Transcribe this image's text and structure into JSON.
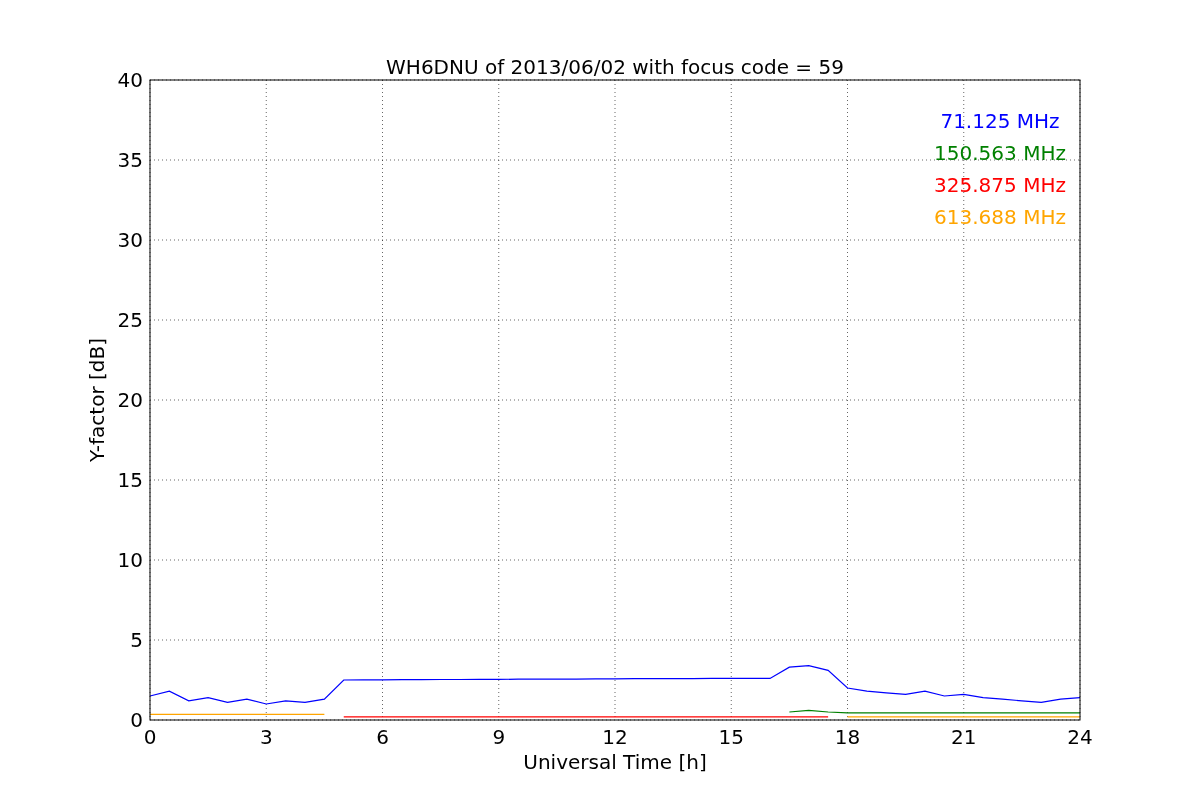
{
  "figure": {
    "chart_data": {
      "type": "line",
      "title": "WH6DNU of 2013/06/02 with focus code = 59",
      "xlabel": "Universal Time [h]",
      "ylabel": "Y-factor [dB]",
      "x": [
        0,
        0.5,
        1,
        1.5,
        2,
        2.5,
        3,
        3.5,
        4,
        4.5,
        5,
        5.5,
        6,
        6.5,
        7,
        7.5,
        8,
        8.5,
        9,
        9.5,
        10,
        10.5,
        11,
        11.5,
        12,
        12.5,
        13,
        13.5,
        14,
        14.5,
        15,
        15.5,
        16,
        16.5,
        17,
        17.5,
        18,
        18.5,
        19,
        19.5,
        20,
        20.5,
        21,
        21.5,
        22,
        22.5,
        23,
        23.5,
        24
      ],
      "series": [
        {
          "name": "71.125 MHz",
          "color": "#0000ff",
          "values": [
            1.5,
            1.8,
            1.2,
            1.4,
            1.1,
            1.3,
            1.0,
            1.2,
            1.1,
            1.3,
            2.5,
            2.51,
            2.51,
            2.52,
            2.52,
            2.53,
            2.53,
            2.54,
            2.54,
            2.55,
            2.55,
            2.56,
            2.56,
            2.57,
            2.57,
            2.58,
            2.58,
            2.59,
            2.59,
            2.6,
            2.6,
            2.6,
            2.6,
            3.3,
            3.4,
            3.1,
            2.0,
            1.8,
            1.7,
            1.6,
            1.8,
            1.5,
            1.6,
            1.4,
            1.3,
            1.2,
            1.1,
            1.3,
            1.4
          ]
        },
        {
          "name": "150.563 MHz",
          "color": "#008000",
          "values": [
            null,
            null,
            null,
            null,
            null,
            null,
            null,
            null,
            null,
            null,
            null,
            null,
            null,
            null,
            null,
            null,
            null,
            null,
            null,
            null,
            null,
            null,
            null,
            null,
            null,
            null,
            null,
            null,
            null,
            null,
            null,
            null,
            null,
            0.5,
            0.6,
            0.5,
            0.45,
            0.45,
            0.45,
            0.45,
            0.45,
            0.45,
            0.45,
            0.45,
            0.45,
            0.45,
            0.45,
            0.45,
            0.45
          ]
        },
        {
          "name": "325.875 MHz",
          "color": "#ff0000",
          "values": [
            null,
            null,
            null,
            null,
            null,
            null,
            null,
            null,
            null,
            null,
            0.2,
            0.2,
            0.2,
            0.2,
            0.2,
            0.2,
            0.2,
            0.2,
            0.2,
            0.2,
            0.2,
            0.2,
            0.2,
            0.2,
            0.2,
            0.2,
            0.2,
            0.2,
            0.2,
            0.2,
            0.2,
            0.2,
            0.2,
            0.2,
            0.2,
            0.2,
            null,
            null,
            null,
            null,
            null,
            null,
            null,
            null,
            null,
            null,
            null,
            null,
            null
          ]
        },
        {
          "name": "613.688 MHz",
          "color": "#ffa500",
          "values": [
            0.35,
            0.35,
            0.35,
            0.35,
            0.35,
            0.35,
            0.35,
            0.35,
            0.35,
            0.35,
            null,
            null,
            null,
            null,
            null,
            null,
            null,
            null,
            null,
            null,
            null,
            null,
            null,
            null,
            null,
            null,
            null,
            null,
            null,
            null,
            null,
            null,
            null,
            null,
            null,
            null,
            0.2,
            0.2,
            0.2,
            0.2,
            0.2,
            0.2,
            0.2,
            0.2,
            0.2,
            0.2,
            0.2,
            0.2,
            0.2
          ]
        }
      ],
      "xlim": [
        0,
        24
      ],
      "ylim": [
        0,
        40
      ],
      "xticks": [
        0,
        3,
        6,
        9,
        12,
        15,
        18,
        21,
        24
      ],
      "yticks": [
        0,
        5,
        10,
        15,
        20,
        25,
        30,
        35,
        40
      ],
      "grid": true
    }
  }
}
